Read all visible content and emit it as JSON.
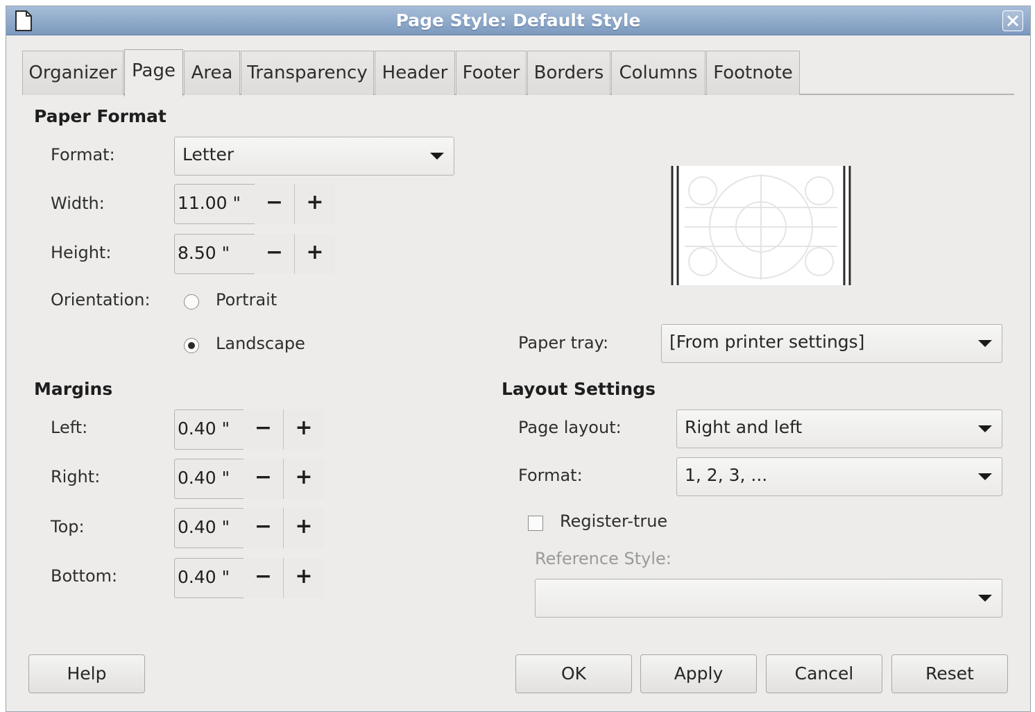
{
  "window": {
    "title": "Page Style: Default Style",
    "title_icon": "document-icon",
    "close_icon": "close-icon"
  },
  "tabs": [
    {
      "label": "Organizer",
      "active": false
    },
    {
      "label": "Page",
      "active": true
    },
    {
      "label": "Area",
      "active": false
    },
    {
      "label": "Transparency",
      "active": false
    },
    {
      "label": "Header",
      "active": false
    },
    {
      "label": "Footer",
      "active": false
    },
    {
      "label": "Borders",
      "active": false
    },
    {
      "label": "Columns",
      "active": false
    },
    {
      "label": "Footnote",
      "active": false
    }
  ],
  "paper_format": {
    "section_title": "Paper Format",
    "format_label": "Format:",
    "format_value": "Letter",
    "width_label": "Width:",
    "width_value": "11.00 \"",
    "height_label": "Height:",
    "height_value": "8.50 \"",
    "orientation_label": "Orientation:",
    "portrait_label": "Portrait",
    "portrait_selected": false,
    "landscape_label": "Landscape",
    "landscape_selected": true,
    "paper_tray_label": "Paper tray:",
    "paper_tray_value": "[From printer settings]"
  },
  "margins": {
    "section_title": "Margins",
    "left_label": "Left:",
    "left_value": "0.40 \"",
    "right_label": "Right:",
    "right_value": "0.40 \"",
    "top_label": "Top:",
    "top_value": "0.40 \"",
    "bottom_label": "Bottom:",
    "bottom_value": "0.40 \""
  },
  "layout_settings": {
    "section_title": "Layout Settings",
    "page_layout_label": "Page layout:",
    "page_layout_value": "Right and left",
    "format_label": "Format:",
    "format_value": "1, 2, 3, ...",
    "register_true_label": "Register-true",
    "register_true_checked": false,
    "reference_style_label": "Reference Style:",
    "reference_style_value": ""
  },
  "spin": {
    "minus": "−",
    "plus": "+"
  },
  "buttons": {
    "help": "Help",
    "ok": "OK",
    "apply": "Apply",
    "cancel": "Cancel",
    "reset": "Reset"
  },
  "colors": {
    "titlebar": "#8aa6c9",
    "dialog_bg": "#edeceb",
    "text": "#2b2b2b",
    "disabled_text": "#9a9a9a"
  }
}
